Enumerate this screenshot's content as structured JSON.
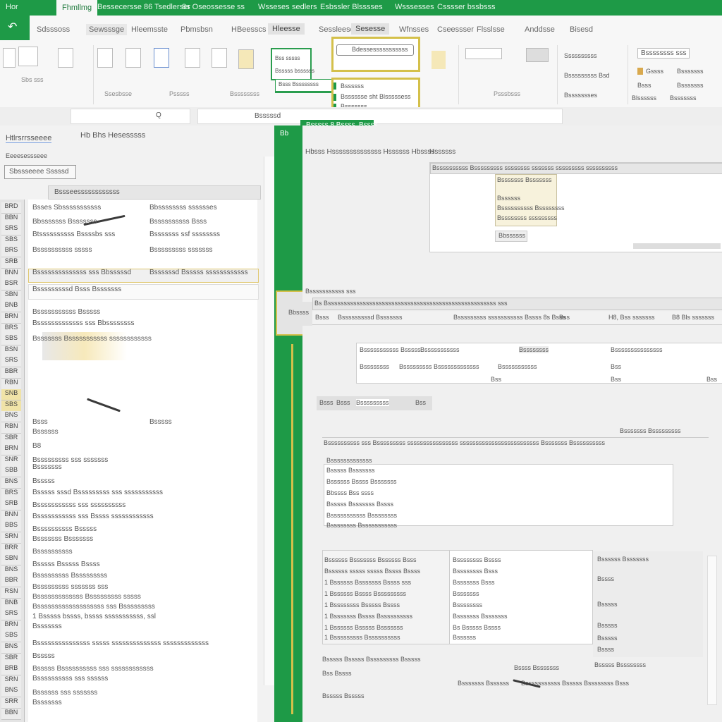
{
  "titlebar": {
    "items": [
      "Hor",
      "Fhmllmg",
      "Bessecersse 86 Tsedlerser",
      "8s Oseossesse",
      "ss",
      "Wsseses",
      "sedlers",
      "Esbssler Blsssses",
      "Wsssesses",
      "Csssser bssbsss"
    ]
  },
  "ribbon_tabs": {
    "items": [
      "Sdsssoss",
      "Sewsssge",
      "Hleemsste",
      "Pbmsbsn",
      "HBeesscs",
      "Hleesse",
      "Sessleeser",
      "Sesesse",
      "Wfnsses",
      "Cseessser",
      "Flsslsse",
      "Anddsse",
      "Bisesd"
    ],
    "selected_index": 4
  },
  "ribbon": {
    "labels": [
      "Sbs sss",
      "Ssesbsse",
      "Psssss",
      "Bssssssss",
      "Psssbsss"
    ],
    "callout_yellow": {
      "header": "Bdessesssssssssss",
      "items": [
        "Bssssss",
        "Bsssssse sht Blsssssess",
        "Bsssssss"
      ]
    },
    "callout_green": {
      "lines": [
        "Bss sssss",
        "Bsssss bssssss",
        "Bsss Bssssssss"
      ]
    },
    "right_group": {
      "title": "Bssssssss sss",
      "items": [
        "Ssssssssss",
        "Bsssssssss Bsd",
        "Bssssssses",
        "Gssss",
        "Bsssssss",
        "Bsss",
        "Bsssssss",
        "Blssssss",
        "Bsssssss"
      ]
    }
  },
  "formula_bar": {
    "name_box": "Q",
    "value": "Bsssssd"
  },
  "left_panel": {
    "header_left": "Htlrsrrsseeee",
    "header_mid": "Hb Bhs Hesesssss",
    "subheader": "Eeeesessseee",
    "button": "Sbssseeee Sssssd",
    "column_header": "Bssseessssssssssss",
    "row_headers": [
      "BRD",
      "BBN",
      "SRS",
      "SBS",
      "BRS",
      "SRB",
      "BNN",
      "BSR",
      "SBN",
      "BNB",
      "BRN",
      "BRS",
      "SBS",
      "BSN",
      "SRS",
      "BBR",
      "RBN",
      "SNB",
      "SBS",
      "BNS",
      "RBN",
      "SBR",
      "BRN",
      "SNR",
      "SBB",
      "BNS",
      "BRS",
      "SRB",
      "BNN",
      "BBS",
      "SRN",
      "BRR",
      "SBN",
      "BNS",
      "BBR",
      "RSN",
      "BNB",
      "SRS",
      "BRN",
      "SBS",
      "BNS",
      "SBR",
      "BRB",
      "SRN",
      "BNS",
      "SRR",
      "BBN"
    ],
    "rows": [
      [
        "Bsses Sbsssssssssss",
        "Bbssssssss sssssses"
      ],
      [
        "Bbsssssss Bsssssss",
        "Bssssssssss Bsss"
      ],
      [
        "Btssssssssss Bssssbs sss",
        "Bsssssss ssf ssssssss"
      ],
      [
        "Bssssssssss sssss",
        "Bsssssssss sssssss"
      ],
      [
        "Bssssssssssssss sss Bbsssssd",
        "Bssssssd Bsssss ssssssssssss"
      ],
      [
        "Bsssssssssd Bsss Bsssssss",
        ""
      ],
      [
        "Bsssssssssss Bsssss",
        ""
      ],
      [
        "Bsssssssssssss sss Bbssssssss",
        ""
      ],
      [
        "Bsssssss Bsssssssssss ssssssssssss",
        ""
      ],
      [
        "Bsss",
        "Bsssss"
      ],
      [
        "Bssssss",
        ""
      ],
      [
        "B8",
        ""
      ],
      [
        "Bsssssssss sss sssssss",
        ""
      ],
      [
        "Bsssssss",
        ""
      ],
      [
        "Bsssss",
        ""
      ],
      [
        "Bsssss sssd Bsssssssss sss sssssssssss",
        ""
      ],
      [
        "Bsssssssssss sss ssssssssss",
        ""
      ],
      [
        "Bsssssssssss sss Bssss ssssssssssss",
        ""
      ],
      [
        "Bssssssssss Bsssss",
        ""
      ],
      [
        "Bsssssss Bsssssss",
        ""
      ],
      [
        "Bssssssssss",
        ""
      ],
      [
        "Bsssss Bsssss Bssss",
        ""
      ],
      [
        "Bsssssssss Bsssssssss",
        ""
      ],
      [
        "Bsssssssss sssssss sss",
        ""
      ],
      [
        "Bsssssssssssss Bsssssssss sssss",
        ""
      ],
      [
        "Bsssssssssssssssssss sss Bsssssssss",
        ""
      ],
      [
        "1 Bsssss bssss, bssss sssssssssss, ssl",
        ""
      ],
      [
        "Bsssssss",
        ""
      ],
      [
        "Bsssssssssssssss sssss ssssssssssssss sssssssssssss",
        ""
      ],
      [
        "Bsssss",
        ""
      ],
      [
        "Bsssss Bssssssssss sss ssssssssssss",
        ""
      ],
      [
        "Bssssssssss sss ssssss",
        ""
      ],
      [
        "Bssssss sss sssssss",
        ""
      ],
      [
        "Bsssssss",
        ""
      ]
    ]
  },
  "divider": {
    "label": "Bb",
    "header": "Bsssss 8 Bssss. Bssss"
  },
  "right_pane": {
    "top_label": "Hbsss Hssssssssssssss Hssssss Hbssss",
    "top_right_label": "Hssssss",
    "dialog_header": "Bssssssssss Bsssssssss ssssssss sssssss sssssssss ssssssssss",
    "dropdown": [
      "Bsssssss Bsssssss",
      "Bssssss",
      "Bssssssssss Bssssssss",
      "Bssssssss sssssssss"
    ],
    "dropdown_footer": "Bbssssss",
    "mid_label": "Bsssssssssss sss",
    "mid_left": "Bbssss",
    "mid_header": "Bs Bsssssssssssssssssssssssssssssssssssssssssssssssssssss sss",
    "mid_row": [
      "Bsss",
      "Bsssssssssd Bsssssss",
      "Bsssssssss sssssssssss Bssss 8s Bsss",
      "Bss",
      "H8, Bss sssssss",
      "B8 Bls sssssss"
    ],
    "mid_grid": [
      "Bsssssssssss Bsssss",
      "Bsssssssssss",
      "Bssssssss",
      "Bsssssssssssssss",
      "Bssssssss",
      "Bsssssssss Bsssssssssssss",
      "Bsssssssssss",
      "Bss",
      "Bss",
      "Bss",
      "Bss"
    ],
    "lower_tabs": [
      "Bsss",
      "Bsss",
      "Bsssssssss",
      "Bss"
    ],
    "lower_header": "Bssssssssss sss Bsssssssss ssssssssssssssss sssssssssssssssssssssssss Bsssssss Bssssssssss",
    "lower_right": "Bsssssss Bsssssssss",
    "list_a": [
      "Bsssssssssssss",
      "Bsssss Bsssssss",
      "Bssssss Bssss Bsssssss",
      "Bbssss Bss ssss",
      "Bsssss Bsssssss Bssss",
      "Bsssssssssss Bssssssss",
      "Bssssssss Bsssssssssss"
    ],
    "table_left": [
      "Bssssss Bsssssss Bssssss Bsss",
      "Bssssss sssss sssss Bssss Bssss",
      "1 Bssssss Bsssssss Bssss sss",
      "1 Bssssss Bssss Bsssssssss",
      "1 Bssssssss Bsssss Bssss",
      "1 Bsssssss Bssss Bssssssssss",
      "1 Bssssss Bsssss Bsssssss",
      "1 Bsssssssss Bssssssssss"
    ],
    "table_right": [
      "Bssssssss Bssss",
      "Bssssssss Bsss",
      "Bsssssss Bsss",
      "Bsssssss",
      "Bssssssss",
      "Bsssssss Bsssssss",
      "Bs Bsssss Bssss",
      "Bssssss"
    ],
    "right_col": [
      "Bssssss Bsssssss",
      "Bssss",
      "Bsssss",
      "Bsssss",
      "Bsssss",
      "Bssss"
    ],
    "footer": [
      "Bsssss Bsssss Bsssssssss Bsssss",
      "Bssss Bsssssss",
      "Bss Bssss",
      "Bsssss Bssssssss",
      "Bsssssss Bssssss",
      "Bsssssssssss Bsssss Bssssssss Bsss",
      "Bsssss Bsssss"
    ]
  },
  "colors": {
    "accent": "#1e9a47",
    "highlight": "#d4c04a",
    "selection": "#f0e3a8"
  }
}
